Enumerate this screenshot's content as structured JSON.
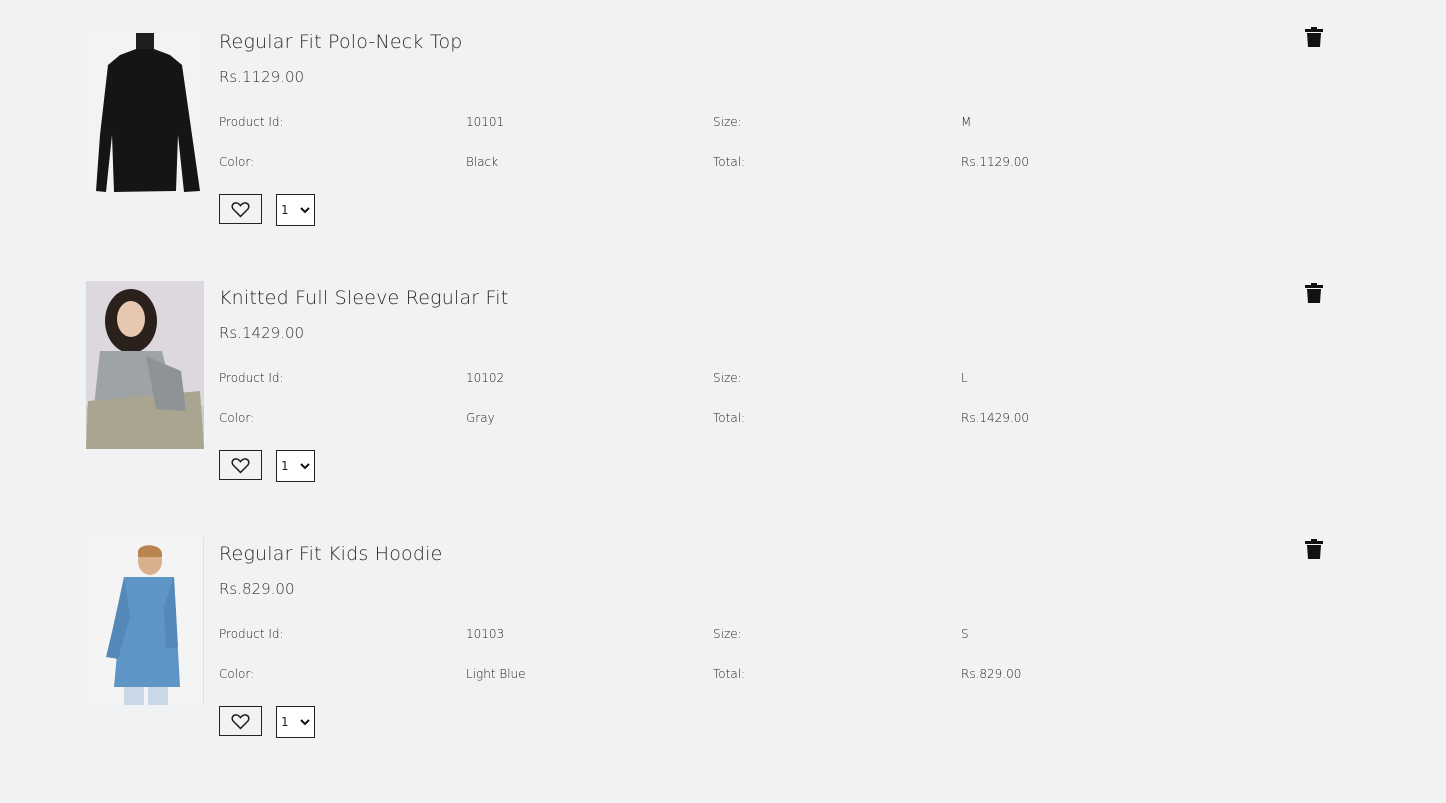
{
  "labels": {
    "product_id": "Product Id:",
    "size": "Size:",
    "color": "Color:",
    "total": "Total:"
  },
  "items": [
    {
      "title": "Regular Fit Polo-Neck Top",
      "price": "Rs.1129.00",
      "product_id": "10101",
      "size": "M",
      "color": "Black",
      "total": "Rs.1129.00",
      "quantity": "1",
      "image_icon": "black-polo-neck-top-image"
    },
    {
      "title": "Knitted Full Sleeve Regular Fit",
      "price": "Rs.1429.00",
      "product_id": "10102",
      "size": "L",
      "color": "Gray",
      "total": "Rs.1429.00",
      "quantity": "1",
      "image_icon": "model-in-gray-knit-sweater-image"
    },
    {
      "title": "Regular Fit Kids Hoodie",
      "price": "Rs.829.00",
      "product_id": "10103",
      "size": "S",
      "color": "Light Blue",
      "total": "Rs.829.00",
      "quantity": "1",
      "image_icon": "boy-in-blue-hoodie-image"
    }
  ],
  "icons": {
    "wishlist": "heart-icon",
    "remove": "trash-icon",
    "dropdown": "chevron-down-icon"
  }
}
